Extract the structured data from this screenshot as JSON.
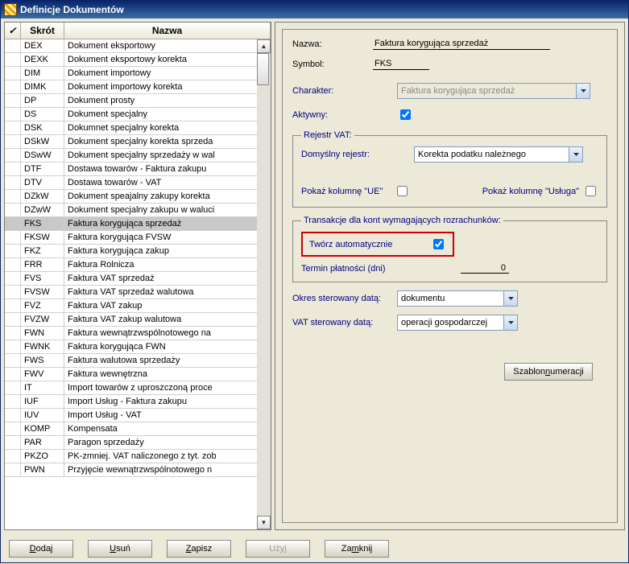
{
  "window": {
    "title": "Definicje Dokumentów"
  },
  "grid": {
    "check_header": "✓",
    "col_skrot": "Skrót",
    "col_nazwa": "Nazwa",
    "selected_skrot": "FKS",
    "rows": [
      {
        "s": "DEX",
        "n": "Dokument eksportowy"
      },
      {
        "s": "DEXK",
        "n": "Dokument eksportowy korekta"
      },
      {
        "s": "DIM",
        "n": "Dokument importowy"
      },
      {
        "s": "DIMK",
        "n": "Dokument importowy korekta"
      },
      {
        "s": "DP",
        "n": "Dokument prosty"
      },
      {
        "s": "DS",
        "n": "Dokument specjalny"
      },
      {
        "s": "DSK",
        "n": "Dokumnet specjalny korekta"
      },
      {
        "s": "DSkW",
        "n": "Dokument specjalny korekta sprzeda"
      },
      {
        "s": "DSwW",
        "n": "Dokument specjalny sprzedaży w wal"
      },
      {
        "s": "DTF",
        "n": "Dostawa towarów - Faktura zakupu"
      },
      {
        "s": "DTV",
        "n": "Dostawa towarów - VAT"
      },
      {
        "s": "DZkW",
        "n": "Dokument speajalny zakupy korekta"
      },
      {
        "s": "DZwW",
        "n": "Dokument specjalny zakupu w waluci"
      },
      {
        "s": "FKS",
        "n": "Faktura korygująca sprzedaż"
      },
      {
        "s": "FKSW",
        "n": "Faktura korygująca FVSW"
      },
      {
        "s": "FKZ",
        "n": "Faktura korygująca zakup"
      },
      {
        "s": "FRR",
        "n": "Faktura Rolnicza"
      },
      {
        "s": "FVS",
        "n": "Faktura VAT sprzedaż"
      },
      {
        "s": "FVSW",
        "n": "Faktura VAT sprzedaż walutowa"
      },
      {
        "s": "FVZ",
        "n": "Faktura VAT zakup"
      },
      {
        "s": "FVZW",
        "n": "Faktura VAT zakup walutowa"
      },
      {
        "s": "FWN",
        "n": "Faktura wewnątrzwspólnotowego na"
      },
      {
        "s": "FWNK",
        "n": "Faktura korygująca FWN"
      },
      {
        "s": "FWS",
        "n": "Faktura walutowa sprzedaży"
      },
      {
        "s": "FWV",
        "n": "Faktura wewnętrzna"
      },
      {
        "s": "IT",
        "n": "Import towarów z uproszczoną proce"
      },
      {
        "s": "IUF",
        "n": "Import Usług - Faktura zakupu"
      },
      {
        "s": "IUV",
        "n": "Import Usług - VAT"
      },
      {
        "s": "KOMP",
        "n": "Kompensata"
      },
      {
        "s": "PAR",
        "n": "Paragon sprzedaży"
      },
      {
        "s": "PKZO",
        "n": "PK-zmniej. VAT naliczonego z tyt. zob"
      },
      {
        "s": "PWN",
        "n": "Przyjęcie wewnątrzwspólnotowego n"
      }
    ]
  },
  "form": {
    "nazwa_label": "Nazwa:",
    "nazwa_val": "Faktura korygująca sprzedaż",
    "symbol_label": "Symbol:",
    "symbol_val": "FKS",
    "charakter_label": "Charakter:",
    "charakter_val": "Faktura korygująca sprzedaż",
    "aktywny_label": "Aktywny:"
  },
  "vat": {
    "legend": "Rejestr VAT:",
    "default_label": "Domyślny rejestr:",
    "default_val": "Korekta podatku należnego",
    "col_ue": "Pokaż kolumnę \"UE\"",
    "col_usluga": "Pokaż kolumnę \"Usługa\""
  },
  "trans": {
    "legend": "Transakcje dla kont wymagających rozrachunków:",
    "auto_label": "Twórz automatycznie",
    "termin_label": "Termin płatności (dni)",
    "termin_val": "0"
  },
  "okres": {
    "label": "Okres sterowany datą:",
    "val": "dokumentu"
  },
  "vat_ster": {
    "label": "VAT sterowany datą:",
    "val": "operacji gospodarczej"
  },
  "btns": {
    "szablon": "Szablon numeracji",
    "szablon_accel": "n",
    "dodaj": "Dodaj",
    "dodaj_a": "D",
    "usun": "Usuń",
    "usun_a": "U",
    "zapisz": "Zapisz",
    "zapisz_a": "Z",
    "uzyj": "Użyj",
    "uzyj_a": "U",
    "zamknij": "Zamknij",
    "zamknij_a": "m"
  }
}
